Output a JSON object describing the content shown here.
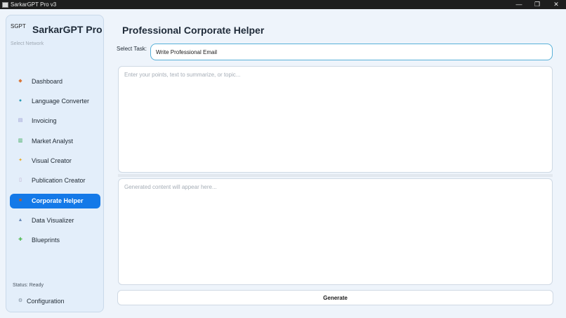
{
  "window": {
    "title": "SarkarGPT Pro v3",
    "controls": {
      "minimize": "—",
      "maximize": "❐",
      "close": "✕"
    }
  },
  "sidebar": {
    "short_brand": "SGPT",
    "brand": "SarkarGPT Pro",
    "network_label": "Select Network",
    "items": [
      {
        "label": "Dashboard",
        "icon": "dashboard-icon",
        "glyph": "◆",
        "color": "#d9773a",
        "active": false
      },
      {
        "label": "Language Converter",
        "icon": "globe-icon",
        "glyph": "●",
        "color": "#2a9bb5",
        "active": false
      },
      {
        "label": "Invoicing",
        "icon": "invoice-icon",
        "glyph": "▤",
        "color": "#9a9ad0",
        "active": false
      },
      {
        "label": "Market Analyst",
        "icon": "chart-icon",
        "glyph": "▥",
        "color": "#3aa856",
        "active": false
      },
      {
        "label": "Visual Creator",
        "icon": "sparkle-icon",
        "glyph": "✦",
        "color": "#e8a81e",
        "active": false
      },
      {
        "label": "Publication Creator",
        "icon": "book-icon",
        "glyph": "▯",
        "color": "#b8a8c8",
        "active": false
      },
      {
        "label": "Corporate Helper",
        "icon": "briefcase-icon",
        "glyph": "■",
        "color": "#b0603a",
        "active": true
      },
      {
        "label": "Data Visualizer",
        "icon": "graph-icon",
        "glyph": "▲",
        "color": "#6a8ab8",
        "active": false
      },
      {
        "label": "Blueprints",
        "icon": "puzzle-icon",
        "glyph": "✚",
        "color": "#4ab84a",
        "active": false
      }
    ],
    "status": "Status: Ready",
    "config": {
      "label": "Configuration",
      "icon": "gear-icon",
      "glyph": "⚙"
    }
  },
  "main": {
    "title": "Professional Corporate Helper",
    "task_label": "Select Task:",
    "task_value": "Write Professional Email",
    "input_placeholder": "Enter your points, text to summarize, or topic...",
    "output_placeholder": "Generated content will appear here...",
    "generate_label": "Generate"
  },
  "colors": {
    "accent": "#1479e8",
    "background": "#eef4fb",
    "sidebar": "#e3eefa"
  }
}
